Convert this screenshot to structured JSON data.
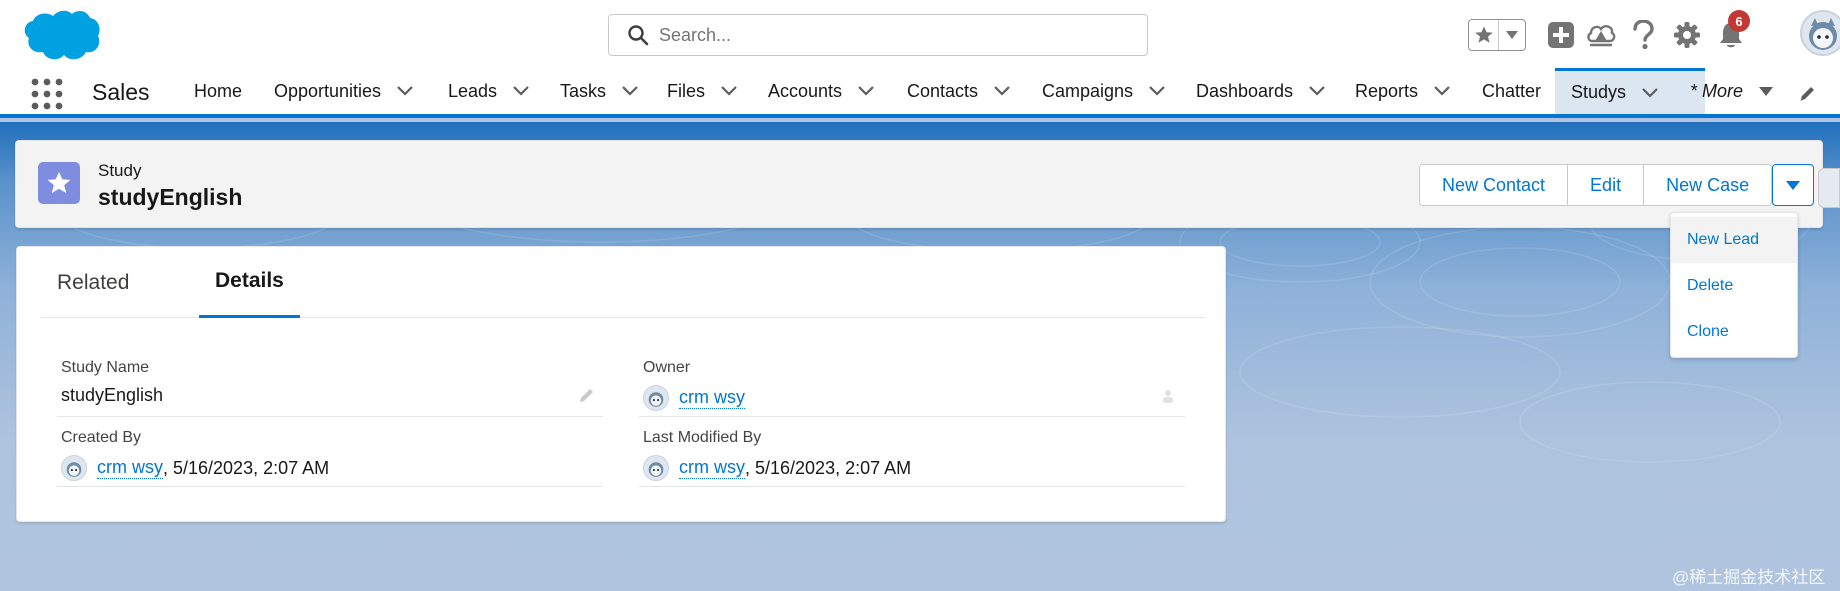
{
  "header": {
    "search_placeholder": "Search...",
    "notification_count": "6",
    "brand_color": "#0176d3"
  },
  "nav": {
    "app_name": "Sales",
    "items": [
      {
        "label": "Home",
        "has_menu": false
      },
      {
        "label": "Opportunities",
        "has_menu": true
      },
      {
        "label": "Leads",
        "has_menu": true
      },
      {
        "label": "Tasks",
        "has_menu": true
      },
      {
        "label": "Files",
        "has_menu": true
      },
      {
        "label": "Accounts",
        "has_menu": true
      },
      {
        "label": "Contacts",
        "has_menu": true
      },
      {
        "label": "Campaigns",
        "has_menu": true
      },
      {
        "label": "Dashboards",
        "has_menu": true
      },
      {
        "label": "Reports",
        "has_menu": true
      },
      {
        "label": "Chatter",
        "has_menu": false
      },
      {
        "label": "Studys",
        "has_menu": true,
        "active": true
      }
    ],
    "more_label": "* More"
  },
  "record": {
    "object_type": "Study",
    "name": "studyEnglish",
    "actions": [
      "New Contact",
      "Edit",
      "New Case"
    ],
    "menu_items": [
      "New Lead",
      "Delete",
      "Clone"
    ]
  },
  "tabs": {
    "related": "Related",
    "details": "Details"
  },
  "details": {
    "study_name_label": "Study Name",
    "study_name_value": "studyEnglish",
    "owner_label": "Owner",
    "owner_value": "crm wsy",
    "created_by_label": "Created By",
    "created_by_user": "crm wsy",
    "created_by_date": ", 5/16/2023, 2:07 AM",
    "modified_by_label": "Last Modified By",
    "modified_by_user": "crm wsy",
    "modified_by_date": ", 5/16/2023, 2:07 AM"
  },
  "watermark": "@稀土掘金技术社区"
}
